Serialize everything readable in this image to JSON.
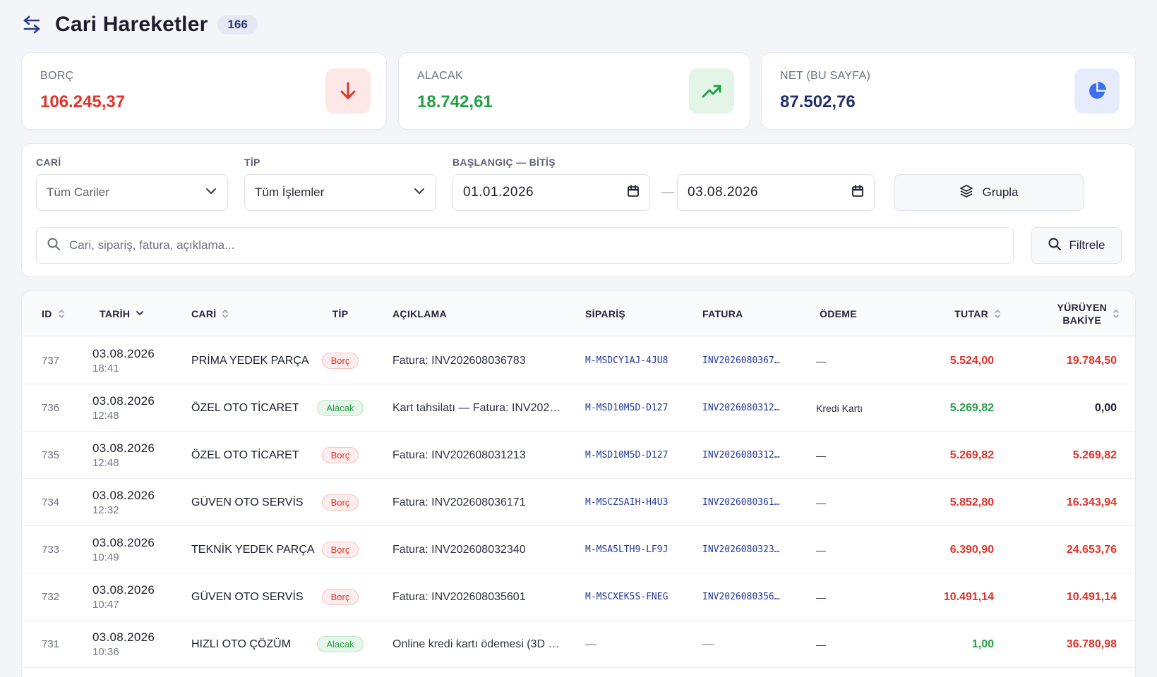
{
  "header": {
    "title": "Cari Hareketler",
    "count": "166"
  },
  "stats": {
    "borc": {
      "label": "BORÇ",
      "value": "106.245,37"
    },
    "alacak": {
      "label": "ALACAK",
      "value": "18.742,61"
    },
    "net": {
      "label": "NET (BU SAYFA)",
      "value": "87.502,76"
    }
  },
  "filters": {
    "cari_label": "CARİ",
    "cari_value": "Tüm Cariler",
    "tip_label": "TİP",
    "tip_value": "Tüm İşlemler",
    "date_label": "BAŞLANGIÇ — BİTİŞ",
    "start_date": "01.01.2026",
    "separator": "—",
    "end_date": "03.08.2026",
    "group_label": "Grupla",
    "search_placeholder": "Cari, sipariş, fatura, açıklama...",
    "filter_label": "Filtrele"
  },
  "table": {
    "columns": {
      "id": "ID",
      "tarih": "TARİH",
      "cari": "CARİ",
      "tip": "TİP",
      "aciklama": "AÇIKLAMA",
      "siparis": "SİPARİŞ",
      "fatura": "FATURA",
      "odeme": "ÖDEME",
      "tutar": "TUTAR",
      "bakiye_line1": "YÜRÜYEN",
      "bakiye_line2": "BAKİYE"
    },
    "rows": [
      {
        "id": "737",
        "date": "03.08.2026",
        "time": "18:41",
        "cari": "PRİMA YEDEK PARÇA",
        "tip": "Borç",
        "aciklama": "Fatura: INV202608036783",
        "siparis": "M-MSDCY1AJ-4JU8",
        "fatura": "INV2026080367…",
        "odeme": "—",
        "tutar": "5.524,00",
        "bakiye": "19.784,50"
      },
      {
        "id": "736",
        "date": "03.08.2026",
        "time": "12:48",
        "cari": "ÖZEL OTO TİCARET",
        "tip": "Alacak",
        "aciklama": "Kart tahsilatı — Fatura: INV202…",
        "siparis": "M-MSD10M5D-D127",
        "fatura": "INV2026080312…",
        "odeme": "Kredi Kartı",
        "tutar": "5.269,82",
        "bakiye": "0,00"
      },
      {
        "id": "735",
        "date": "03.08.2026",
        "time": "12:48",
        "cari": "ÖZEL OTO TİCARET",
        "tip": "Borç",
        "aciklama": "Fatura: INV202608031213",
        "siparis": "M-MSD10M5D-D127",
        "fatura": "INV2026080312…",
        "odeme": "—",
        "tutar": "5.269,82",
        "bakiye": "5.269,82"
      },
      {
        "id": "734",
        "date": "03.08.2026",
        "time": "12:32",
        "cari": "GÜVEN OTO SERVİS",
        "tip": "Borç",
        "aciklama": "Fatura: INV202608036171",
        "siparis": "M-MSCZSAIH-H4U3",
        "fatura": "INV2026080361…",
        "odeme": "—",
        "tutar": "5.852,80",
        "bakiye": "16.343,94"
      },
      {
        "id": "733",
        "date": "03.08.2026",
        "time": "10:49",
        "cari": "TEKNİK YEDEK PARÇA",
        "tip": "Borç",
        "aciklama": "Fatura: INV202608032340",
        "siparis": "M-MSA5LTH9-LF9J",
        "fatura": "INV2026080323…",
        "odeme": "—",
        "tutar": "6.390,90",
        "bakiye": "24.653,76"
      },
      {
        "id": "732",
        "date": "03.08.2026",
        "time": "10:47",
        "cari": "GÜVEN OTO SERVİS",
        "tip": "Borç",
        "aciklama": "Fatura: INV202608035601",
        "siparis": "M-MSCXEK5S-FNEG",
        "fatura": "INV2026080356…",
        "odeme": "—",
        "tutar": "10.491,14",
        "bakiye": "10.491,14"
      },
      {
        "id": "731",
        "date": "03.08.2026",
        "time": "10:36",
        "cari": "HIZLI OTO ÇÖZÜM",
        "tip": "Alacak",
        "aciklama": "Online kredi kartı ödemesi (3D …",
        "siparis": "—",
        "fatura": "—",
        "odeme": "—",
        "tutar": "1,00",
        "bakiye": "36.780,98"
      }
    ]
  },
  "colors": {
    "debit": "#e0342b",
    "credit": "#23a046",
    "net": "#24306b",
    "link": "#243a9c"
  }
}
